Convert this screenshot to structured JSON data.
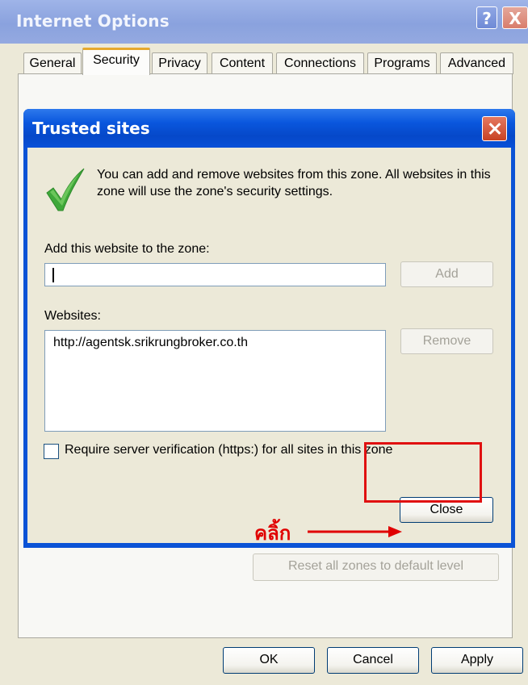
{
  "outer_window": {
    "title": "Internet Options",
    "help_glyph": "?",
    "close_glyph": "X"
  },
  "tabs": [
    {
      "label": "General"
    },
    {
      "label": "Security",
      "active": true
    },
    {
      "label": "Privacy"
    },
    {
      "label": "Content"
    },
    {
      "label": "Connections"
    },
    {
      "label": "Programs"
    },
    {
      "label": "Advanced"
    }
  ],
  "dialog": {
    "title": "Trusted sites",
    "info_text": "You can add and remove websites from this zone. All websites in this zone will use the zone's security settings.",
    "add_label": "Add this website to the zone:",
    "add_input_value": "",
    "add_button": "Add",
    "websites_label": "Websites:",
    "websites": [
      "http://agentsk.srikrungbroker.co.th"
    ],
    "remove_button": "Remove",
    "require_https_label": "Require server verification (https:) for all sites in this zone",
    "require_https_checked": false,
    "close_button": "Close"
  },
  "annotation": {
    "text": "คลิ้ก",
    "color": "#e00000"
  },
  "reset_button": "Reset all zones to default level",
  "footer": {
    "ok": "OK",
    "cancel": "Cancel",
    "apply": "Apply"
  },
  "colors": {
    "dialog_titlebar": "#0a57de",
    "window_face": "#ece9d8",
    "active_tab_accent": "#e6a92d",
    "highlight": "#e01010"
  }
}
